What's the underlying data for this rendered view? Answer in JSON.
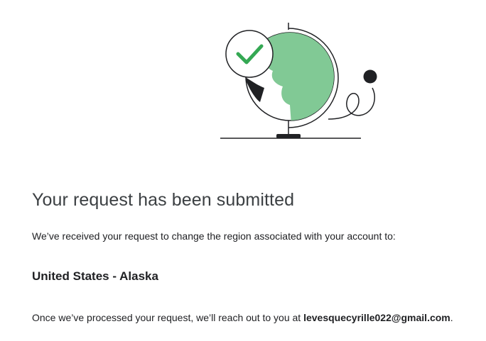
{
  "confirmation": {
    "title": "Your request has been submitted",
    "description": "We’ve received your request to change the region associated with your account to:",
    "region": "United States - Alaska",
    "followup_prefix": "Once we’ve processed your request, we’ll reach out to you at ",
    "email": "levesquecyrille022@gmail.com",
    "followup_suffix": "."
  },
  "colors": {
    "globe_land": "#81c995",
    "check": "#34a853",
    "ink": "#202124"
  },
  "icons": {
    "illustration": "globe-with-checkmark-illustration"
  }
}
